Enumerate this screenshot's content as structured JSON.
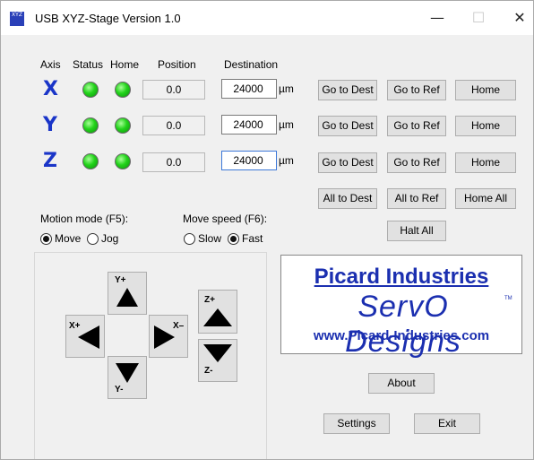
{
  "window": {
    "title": "USB XYZ-Stage Version 1.0",
    "icon_label": "XYZ",
    "controls": {
      "minimize": "—",
      "maximize": "☐",
      "close": "✕"
    }
  },
  "headers": {
    "axis": "Axis",
    "status": "Status",
    "home": "Home",
    "position": "Position",
    "destination": "Destination"
  },
  "axes": [
    {
      "letter": "X",
      "status_led": "green",
      "home_led": "green",
      "position": "0.0",
      "destination": "24000",
      "unit": "µm",
      "go_dest": "Go to Dest",
      "go_ref": "Go to Ref",
      "home": "Home"
    },
    {
      "letter": "Y",
      "status_led": "green",
      "home_led": "green",
      "position": "0.0",
      "destination": "24000",
      "unit": "µm",
      "go_dest": "Go to Dest",
      "go_ref": "Go to Ref",
      "home": "Home"
    },
    {
      "letter": "Z",
      "status_led": "green",
      "home_led": "green",
      "position": "0.0",
      "destination": "24000",
      "unit": "µm",
      "go_dest": "Go to Dest",
      "go_ref": "Go to Ref",
      "home": "Home"
    }
  ],
  "all_buttons": {
    "all_to_dest": "All to Dest",
    "all_to_ref": "All to Ref",
    "home_all": "Home All",
    "halt_all": "Halt All"
  },
  "motion_mode": {
    "label": "Motion mode (F5):",
    "options": [
      "Move",
      "Jog"
    ],
    "selected": "Move"
  },
  "move_speed": {
    "label": "Move speed (F6):",
    "options": [
      "Slow",
      "Fast"
    ],
    "selected": "Fast"
  },
  "jog": {
    "y_plus": "Y+",
    "y_minus": "Y-",
    "x_plus": "X+",
    "x_minus": "X–",
    "z_plus": "Z+",
    "z_minus": "Z-"
  },
  "logo": {
    "company": "Picard Industries",
    "brand": "ServO Designs",
    "tm": "TM",
    "url": "www.Picard-Industries.com"
  },
  "buttons": {
    "about": "About",
    "settings": "Settings",
    "exit": "Exit"
  },
  "colors": {
    "axis_letter": "#1a35c8",
    "led_on": "#22d31a",
    "logo_text": "#1b2fb0"
  }
}
